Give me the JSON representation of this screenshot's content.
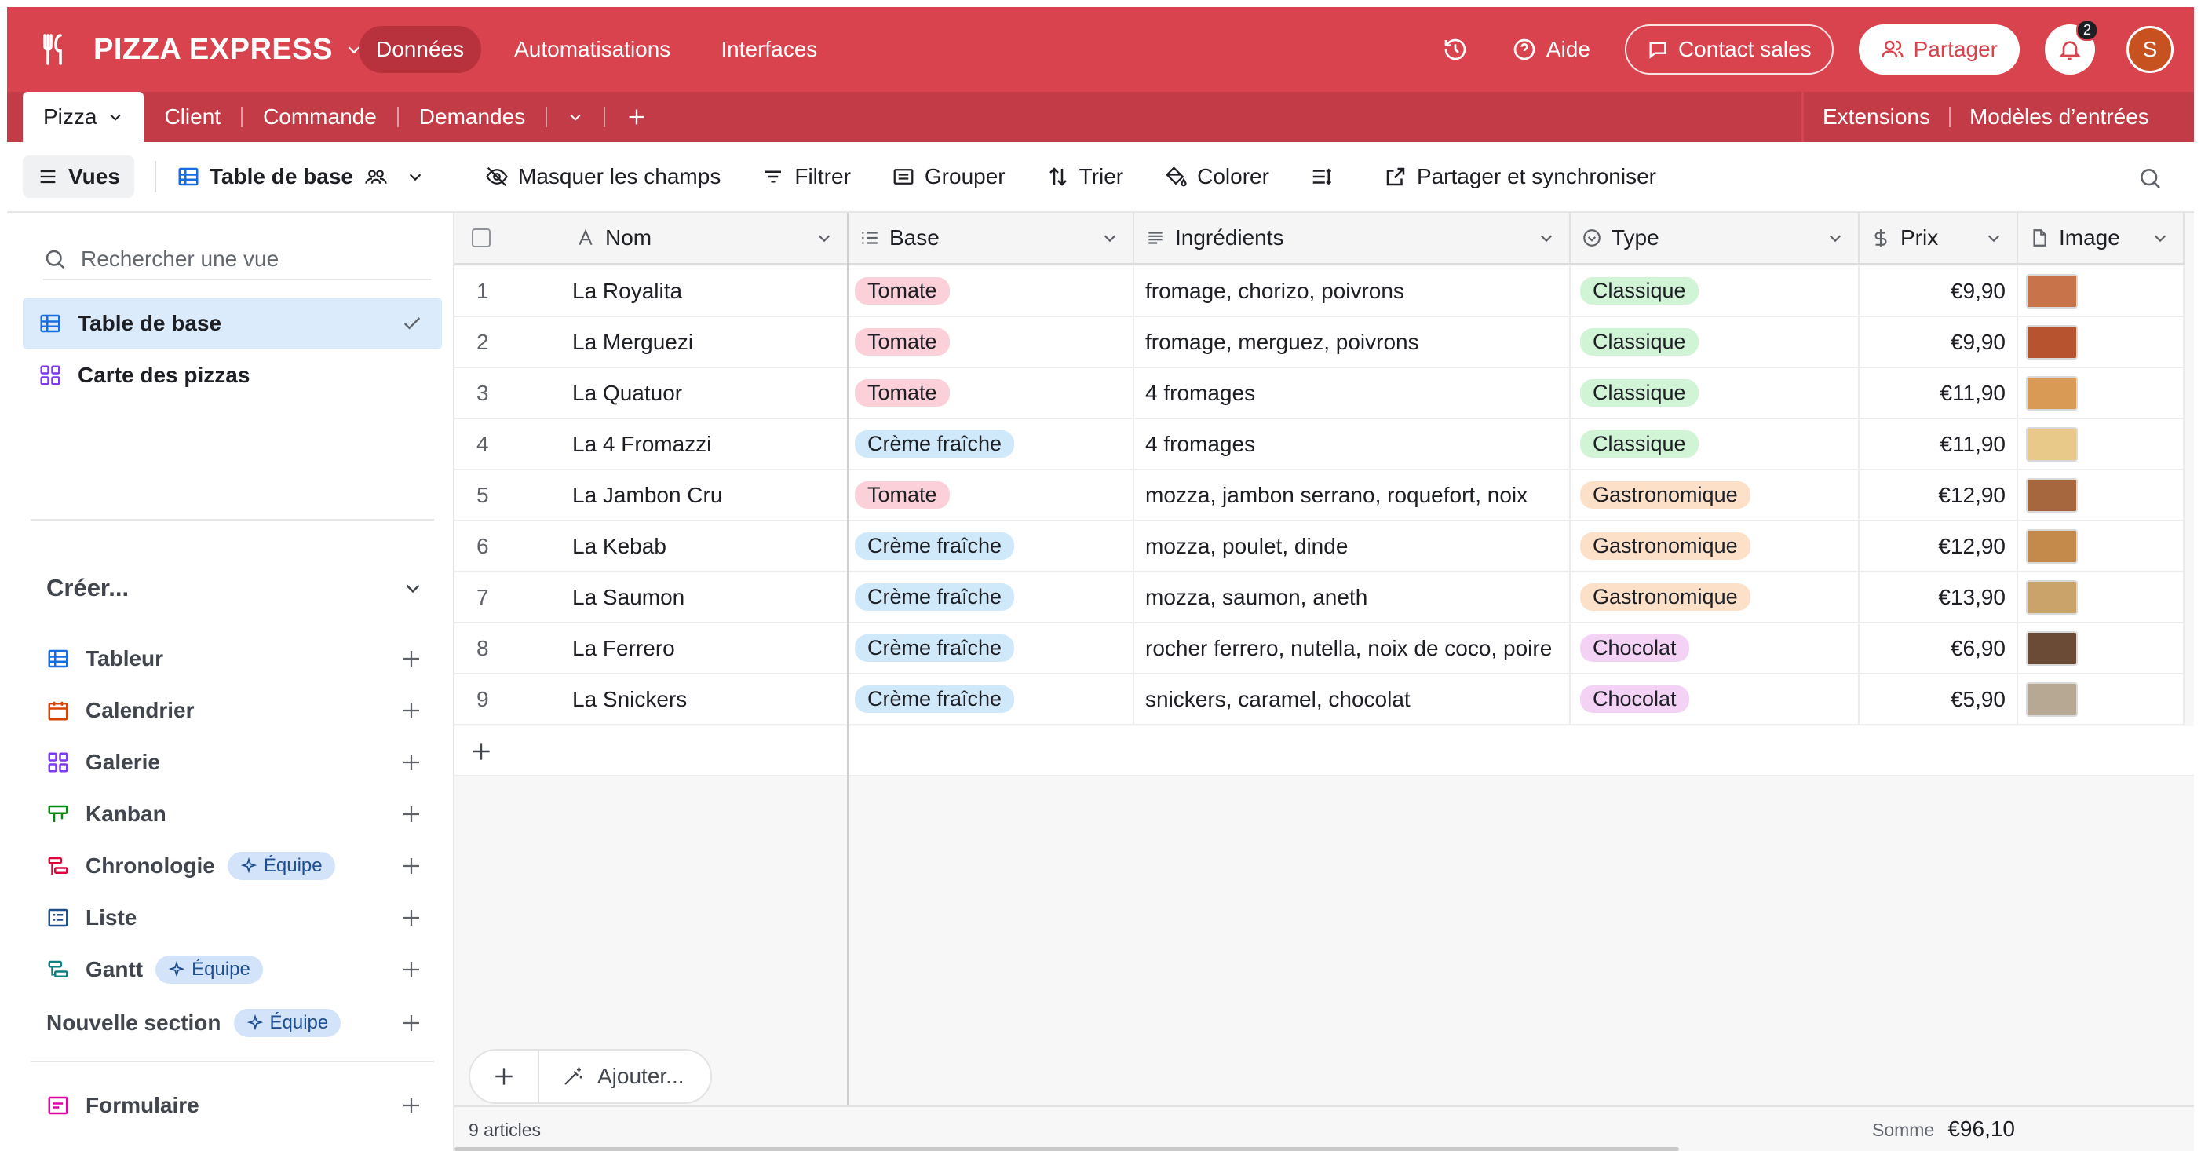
{
  "app": {
    "name": "PIZZA EXPRESS",
    "nav": [
      "Données",
      "Automatisations",
      "Interfaces"
    ],
    "help_label": "Aide",
    "contact_label": "Contact sales",
    "share_label": "Partager",
    "notif_count": "2",
    "avatar_letter": "S",
    "brand_color": "#d8434e"
  },
  "tables": {
    "tabs": [
      "Pizza",
      "Client",
      "Commande",
      "Demandes"
    ],
    "extensions_label": "Extensions",
    "templates_label": "Modèles d’entrées"
  },
  "toolbar": {
    "views_label": "Vues",
    "view_name": "Table de base",
    "hide_fields": "Masquer les champs",
    "filter": "Filtrer",
    "group": "Grouper",
    "sort": "Trier",
    "color": "Colorer",
    "share_sync": "Partager et synchroniser"
  },
  "sidebar": {
    "search_placeholder": "Rechercher une vue",
    "views": [
      "Table de base",
      "Carte des pizzas"
    ],
    "create_label": "Créer...",
    "create_items": [
      {
        "label": "Tableur",
        "icon": "grid-icon",
        "team": ""
      },
      {
        "label": "Calendrier",
        "icon": "calendar-icon",
        "team": ""
      },
      {
        "label": "Galerie",
        "icon": "gallery-icon",
        "team": ""
      },
      {
        "label": "Kanban",
        "icon": "kanban-icon",
        "team": ""
      },
      {
        "label": "Chronologie",
        "icon": "timeline-icon",
        "team": "Équipe"
      },
      {
        "label": "Liste",
        "icon": "list-icon",
        "team": ""
      },
      {
        "label": "Gantt",
        "icon": "gantt-icon",
        "team": "Équipe"
      },
      {
        "label": "Nouvelle section",
        "icon": "",
        "team": "Équipe"
      }
    ],
    "form_label": "Formulaire"
  },
  "grid": {
    "columns": [
      "Nom",
      "Base",
      "Ingrédients",
      "Type",
      "Prix",
      "Image"
    ],
    "rows": [
      {
        "n": "1",
        "nom": "La Royalita",
        "base": "Tomate",
        "ingredients": "fromage, chorizo, poivrons",
        "type": "Classique",
        "prix": "€9,90"
      },
      {
        "n": "2",
        "nom": "La Merguezi",
        "base": "Tomate",
        "ingredients": "fromage, merguez, poivrons",
        "type": "Classique",
        "prix": "€9,90"
      },
      {
        "n": "3",
        "nom": "La Quatuor",
        "base": "Tomate",
        "ingredients": "4 fromages",
        "type": "Classique",
        "prix": "€11,90"
      },
      {
        "n": "4",
        "nom": "La 4 Fromazzi",
        "base": "Crème fraîche",
        "ingredients": "4 fromages",
        "type": "Classique",
        "prix": "€11,90"
      },
      {
        "n": "5",
        "nom": "La Jambon Cru",
        "base": "Tomate",
        "ingredients": "mozza, jambon serrano, roquefort, noix",
        "type": "Gastronomique",
        "prix": "€12,90"
      },
      {
        "n": "6",
        "nom": "La Kebab",
        "base": "Crème fraîche",
        "ingredients": "mozza, poulet, dinde",
        "type": "Gastronomique",
        "prix": "€12,90"
      },
      {
        "n": "7",
        "nom": "La Saumon",
        "base": "Crème fraîche",
        "ingredients": "mozza, saumon, aneth",
        "type": "Gastronomique",
        "prix": "€13,90"
      },
      {
        "n": "8",
        "nom": "La Ferrero",
        "base": "Crème fraîche",
        "ingredients": "rocher ferrero, nutella, noix de coco, poire",
        "type": "Chocolat",
        "prix": "€6,90"
      },
      {
        "n": "9",
        "nom": "La Snickers",
        "base": "Crème fraîche",
        "ingredients": "snickers, caramel, chocolat",
        "type": "Chocolat",
        "prix": "€5,90"
      }
    ],
    "add_label": "Ajouter...",
    "record_count": "9 articles",
    "sum_label": "Somme",
    "sum_value": "€96,10"
  }
}
